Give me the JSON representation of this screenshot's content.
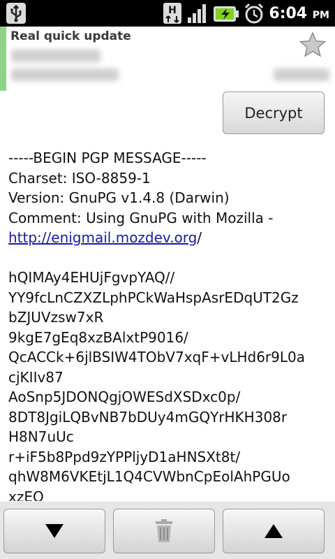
{
  "status_bar": {
    "time": "6:04",
    "ampm": "PM",
    "network_label": "H",
    "icons": [
      "usb-icon",
      "hspa-icon",
      "signal-icon",
      "battery-charging-icon",
      "alarm-icon"
    ]
  },
  "header": {
    "subject": "Real quick update",
    "accent_color": "#8fd38a"
  },
  "decrypt_button": {
    "label": "Decrypt"
  },
  "message": {
    "lines": [
      "-----BEGIN PGP MESSAGE-----",
      "Charset: ISO-8859-1",
      "Version: GnuPG v1.4.8 (Darwin)",
      "Comment: Using GnuPG with Mozilla -",
      "",
      "",
      "hQIMAy4EHUjFgvpYAQ//",
      "YY9fcLnCZXZLphPCkWaHspAsrEDqUT2Gz",
      "bZJUVzsw7xR",
      "9kgE7gEq8xzBAlxtP9016/",
      "QcACCk+6jlBSIW4TObV7xqF+vLHd6r9L0a",
      "cjKIIv87",
      "AoSnp5JDONQgjOWESdXSDxc0p/",
      "8DT8JgiLQBvNB7bDUy4mGQYrHKH308r",
      "H8N7uUc",
      "r+iF5b8Ppd9zYPPljyD1aHNSXt8t/",
      "qhW8M6VKEtjL1Q4CVWbnCpEolAhPGUo",
      "xzEQ"
    ],
    "link_text": "http://enigmail.mozdev.org",
    "link_suffix": "/",
    "link_color": "#1a1aa6"
  },
  "bottom_bar": {
    "buttons": [
      "next-message-button",
      "delete-button",
      "previous-message-button"
    ]
  }
}
